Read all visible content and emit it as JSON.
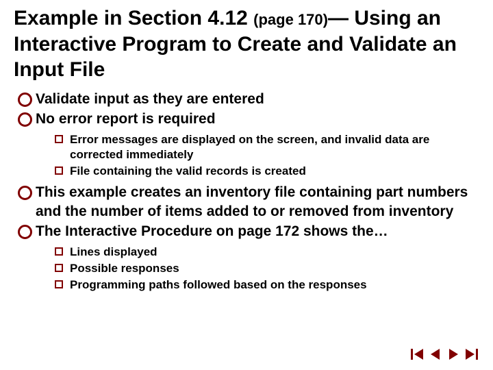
{
  "title": {
    "part1": "Example in Section 4.12 ",
    "page_ref": "(page 170)",
    "part2": "— Using an Interactive Program to Create and Validate an Input File"
  },
  "bullets": {
    "b1": "Validate input as they are entered",
    "b2": "No error report is required",
    "b2_sub": {
      "s1": "Error messages are displayed on the screen, and invalid data are corrected immediately",
      "s2": "File containing the valid records is created"
    },
    "b3": "This example creates an inventory file containing part numbers and the number of items added to or removed from inventory",
    "b4": "The Interactive Procedure on page 172 shows the…",
    "b4_sub": {
      "s1": "Lines displayed",
      "s2": "Possible responses",
      "s3": "Programming paths followed based on the responses"
    }
  },
  "nav": {
    "first": "first-slide",
    "prev": "previous-slide",
    "next": "next-slide",
    "last": "last-slide"
  },
  "colors": {
    "accent": "#800000"
  }
}
